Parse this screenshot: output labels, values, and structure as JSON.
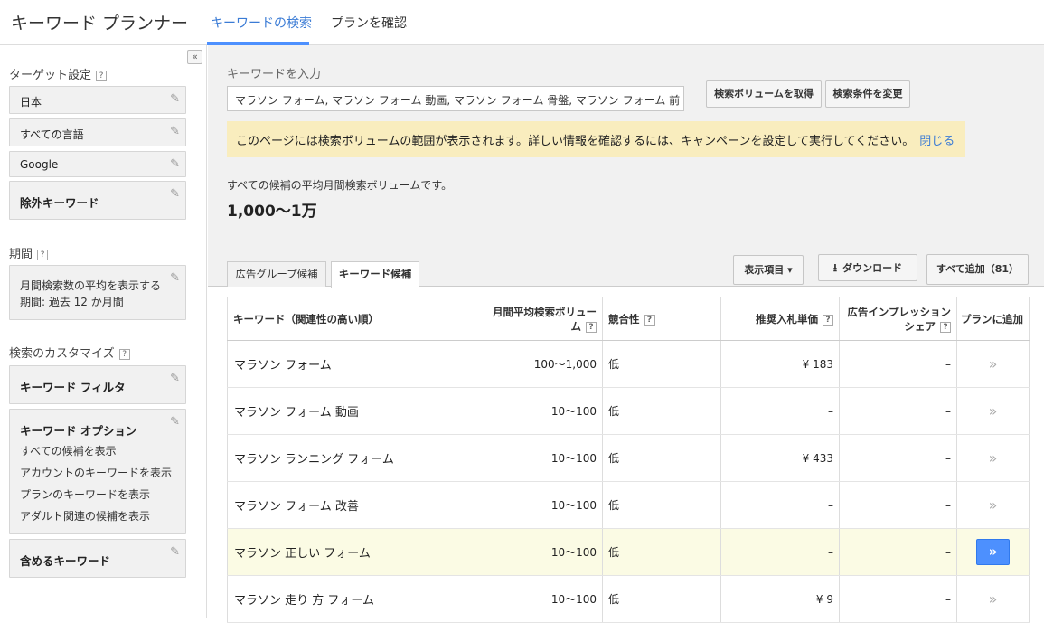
{
  "header": {
    "app_title": "キーワード プランナー",
    "tabs": [
      {
        "label": "キーワードの検索",
        "active": true
      },
      {
        "label": "プランを確認",
        "active": false
      }
    ]
  },
  "sidebar": {
    "collapse_glyph": "«",
    "target_heading": "ターゲット設定",
    "target_items": [
      "日本",
      "すべての言語",
      "Google",
      "除外キーワード"
    ],
    "period_heading": "期間",
    "period_lines": [
      "月間検索数の平均を表示する",
      "期間: 過去 12 か月間"
    ],
    "custom_heading": "検索のカスタマイズ",
    "keyword_filter": "キーワード フィルタ",
    "keyword_options": {
      "title": "キーワード オプション",
      "lines": [
        "すべての候補を表示",
        "アカウントのキーワードを表示",
        "プランのキーワードを表示",
        "アダルト関連の候補を表示"
      ]
    },
    "include_keywords": "含めるキーワード"
  },
  "main": {
    "input_label": "キーワードを入力",
    "input_value": "マラソン フォーム, マラソン フォーム 動画, マラソン フォーム 骨盤, マラソン フォーム 前",
    "btn_get_volume": "検索ボリュームを取得",
    "btn_change_criteria": "検索条件を変更",
    "notice_text": "このページには検索ボリュームの範囲が表示されます。詳しい情報を確認するには、キャンペーンを設定して実行してください。",
    "notice_close": "閉じる",
    "avg_text": "すべての候補の平均月間検索ボリュームです。",
    "avg_value": "1,000～1万",
    "subtabs": [
      "広告グループ候補",
      "キーワード候補"
    ],
    "btn_columns": "表示項目 ▾",
    "btn_download": "ダウンロード",
    "btn_add_all": "すべて追加（81）",
    "table": {
      "headers": {
        "keyword": "キーワード（関連性の高い順）",
        "volume_line1": "月間平均検索ボリュー",
        "volume_line2": "ム",
        "competition": "競合性",
        "bid": "推奨入札単価",
        "share_line1": "広告インプレッション",
        "share_line2": "シェア",
        "add": "プランに追加"
      },
      "rows": [
        {
          "keyword": "マラソン フォーム",
          "volume": "100～1,000",
          "competition": "低",
          "bid": "¥ 183",
          "share": "–",
          "add": "»"
        },
        {
          "keyword": "マラソン フォーム 動画",
          "volume": "10～100",
          "competition": "低",
          "bid": "–",
          "share": "–",
          "add": "»"
        },
        {
          "keyword": "マラソン ランニング フォーム",
          "volume": "10～100",
          "competition": "低",
          "bid": "¥ 433",
          "share": "–",
          "add": "»"
        },
        {
          "keyword": "マラソン フォーム 改善",
          "volume": "10～100",
          "competition": "低",
          "bid": "–",
          "share": "–",
          "add": "»"
        },
        {
          "keyword": "マラソン 正しい フォーム",
          "volume": "10～100",
          "competition": "低",
          "bid": "–",
          "share": "–",
          "add": "»"
        },
        {
          "keyword": "マラソン 走り 方 フォーム",
          "volume": "10～100",
          "competition": "低",
          "bid": "¥ 9",
          "share": "–",
          "add": "»"
        }
      ]
    }
  },
  "colors": {
    "accent": "#4d90fe",
    "notice_bg": "#f9edbe",
    "highlight_row": "#fbfbe4"
  }
}
